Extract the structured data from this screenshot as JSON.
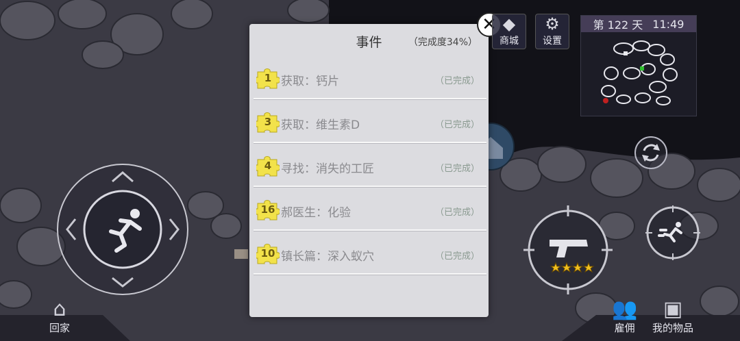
{
  "hud": {
    "shop_label": "商城",
    "shop_icon": "diamond-icon",
    "settings_label": "设置",
    "settings_icon": "gear-icon",
    "day_label": "第 122 天",
    "time": "11:49",
    "home_label": "回家",
    "hire_label": "雇佣",
    "items_label": "我的物品",
    "weapon_stars": 4
  },
  "dialog": {
    "title": "事件",
    "progress": "（完成度34%）",
    "close_icon": "close-icon",
    "events": [
      {
        "num": "1",
        "name": "获取：钙片",
        "status": "（已完成）"
      },
      {
        "num": "3",
        "name": "获取：维生素D",
        "status": "（已完成）"
      },
      {
        "num": "4",
        "name": "寻找：消失的工匠",
        "status": "（已完成）"
      },
      {
        "num": "16",
        "name": "郝医生：化验",
        "status": "（已完成）"
      },
      {
        "num": "10",
        "name": "镇长篇：深入蚁穴",
        "status": "（已完成）"
      }
    ]
  },
  "colors": {
    "puzzle": "#f2e24a",
    "dialog_bg": "#dcdce0",
    "star": "#f0c020"
  }
}
